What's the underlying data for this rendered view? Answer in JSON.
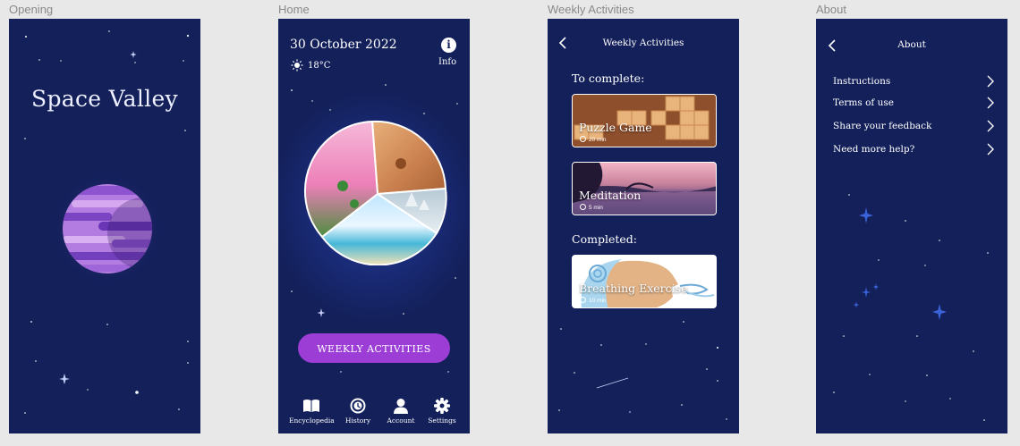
{
  "frames": [
    {
      "label": "Opening"
    },
    {
      "label": "Home"
    },
    {
      "label": "Weekly Activities"
    },
    {
      "label": "About"
    }
  ],
  "opening": {
    "app_title": "Space Valley"
  },
  "home": {
    "date": "30 October 2022",
    "temperature": "18°C",
    "info_label": "Info",
    "weekly_button": "WEEKLY ACTIVITIES",
    "nav": [
      {
        "label": "Encyclopedia",
        "icon": "book-icon"
      },
      {
        "label": "History",
        "icon": "history-clock-icon"
      },
      {
        "label": "Account",
        "icon": "user-icon"
      },
      {
        "label": "Settings",
        "icon": "gear-icon"
      }
    ]
  },
  "weekly": {
    "title": "Weekly Activities",
    "to_complete_heading": "To complete:",
    "completed_heading": "Completed:",
    "to_complete": [
      {
        "title": "Puzzle Game",
        "duration": "20 min"
      },
      {
        "title": "Meditation",
        "duration": "5 min"
      }
    ],
    "completed": [
      {
        "title": "Breathing Exercise",
        "duration": "10 min"
      }
    ]
  },
  "about": {
    "title": "About",
    "items": [
      {
        "label": "Instructions"
      },
      {
        "label": "Terms of use"
      },
      {
        "label": "Share your feedback"
      },
      {
        "label": "Need more help?"
      }
    ]
  },
  "colors": {
    "background": "#13205a",
    "accent": "#9c3ed6",
    "canvas": "#e8e8e8"
  }
}
